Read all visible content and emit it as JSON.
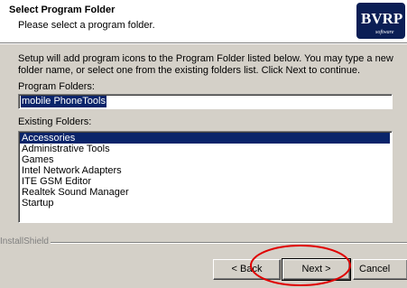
{
  "header": {
    "title": "Select Program Folder",
    "subtitle": "Please select a program folder.",
    "logo_text": "BVRP",
    "logo_sub": "software"
  },
  "description": "Setup will add program icons to the Program Folder listed below.  You may type a new folder name, or select one from the existing folders list.  Click Next to continue.",
  "program_folders": {
    "label": "Program Folders:",
    "value": "mobile PhoneTools"
  },
  "existing_folders": {
    "label": "Existing Folders:",
    "items": [
      {
        "label": "Accessories",
        "selected": true
      },
      {
        "label": "Administrative Tools",
        "selected": false
      },
      {
        "label": "Games",
        "selected": false
      },
      {
        "label": "Intel Network Adapters",
        "selected": false
      },
      {
        "label": "ITE GSM Editor",
        "selected": false
      },
      {
        "label": "Realtek Sound Manager",
        "selected": false
      },
      {
        "label": "Startup",
        "selected": false
      }
    ]
  },
  "footer": {
    "installshield": "InstallShield",
    "back_label": "< Back",
    "next_label": "Next >",
    "cancel_label": "Cancel"
  },
  "colors": {
    "highlight": "#0a246a",
    "annotation": "#e00000",
    "logo_bg": "#0b1e55"
  }
}
